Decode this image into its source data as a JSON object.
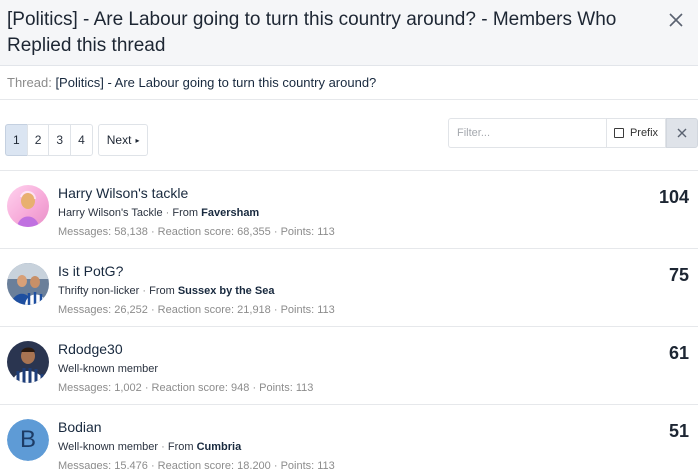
{
  "overlay": {
    "title": "[Politics] - Are Labour going to turn this country around? - Members Who Replied this thread",
    "close_icon": "close-icon"
  },
  "thread": {
    "label": "Thread:",
    "title": "[Politics] - Are Labour going to turn this country around?"
  },
  "pagination": {
    "pages": [
      "1",
      "2",
      "3",
      "4"
    ],
    "current": "1",
    "next_label": "Next"
  },
  "filter": {
    "placeholder": "Filter...",
    "prefix_label": "Prefix",
    "clear_icon": "close-icon"
  },
  "members": [
    {
      "name": "Harry Wilson's tackle",
      "title": "Harry Wilson's Tackle",
      "from_label": "From",
      "location": "Faversham",
      "stats": "Messages: 58,138 · Reaction score: 68,355 · Points: 113",
      "count": "104",
      "avatar_color": "#f5b8dc"
    },
    {
      "name": "Is it PotG?",
      "title": "Thrifty non-licker",
      "from_label": "From",
      "location": "Sussex by the Sea",
      "stats": "Messages: 26,252 · Reaction score: 21,918 · Points: 113",
      "count": "75",
      "avatar_color": "#2d5aa0"
    },
    {
      "name": "Rdodge30",
      "title": "Well-known member",
      "from_label": "",
      "location": "",
      "stats": "Messages: 1,002 · Reaction score: 948 · Points: 113",
      "count": "61",
      "avatar_color": "#1e3e7a"
    },
    {
      "name": "Bodian",
      "title": "Well-known member",
      "from_label": "From",
      "location": "Cumbria",
      "stats": "Messages: 15,476 · Reaction score: 18,200 · Points: 113",
      "count": "51",
      "avatar_letter": "B",
      "avatar_color": "#5e9bd6"
    }
  ]
}
